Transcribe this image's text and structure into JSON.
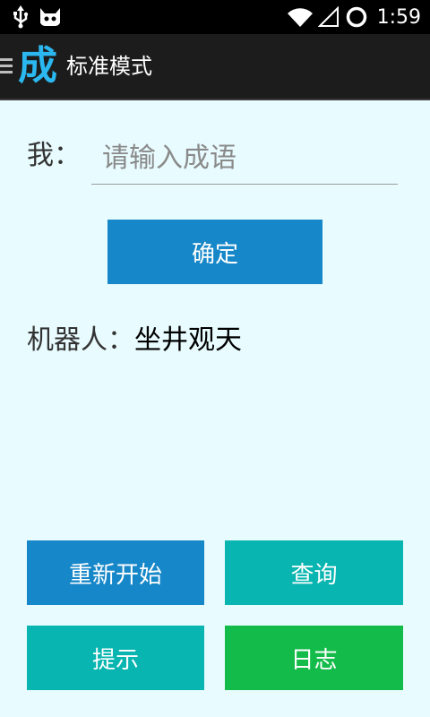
{
  "status_bar": {
    "time": "1:59",
    "icons": [
      "usb-icon",
      "android-debug-icon",
      "wifi-icon",
      "signal-icon",
      "battery-icon"
    ]
  },
  "action_bar": {
    "logo": "成",
    "title": "标准模式"
  },
  "input_row": {
    "label": "我：",
    "placeholder": "请输入成语",
    "value": ""
  },
  "confirm_label": "确定",
  "robot": {
    "label": "机器人：",
    "answer": "坐井观天"
  },
  "buttons": {
    "restart": "重新开始",
    "query": "查询",
    "hint": "提示",
    "log": "日志"
  },
  "colors": {
    "background": "#e8fbfe",
    "action_bar": "#1c1c1c",
    "logo": "#2bb8f0",
    "blue_button": "#1687c8",
    "teal_button": "#08b5b0",
    "green_button": "#13bb4a"
  }
}
